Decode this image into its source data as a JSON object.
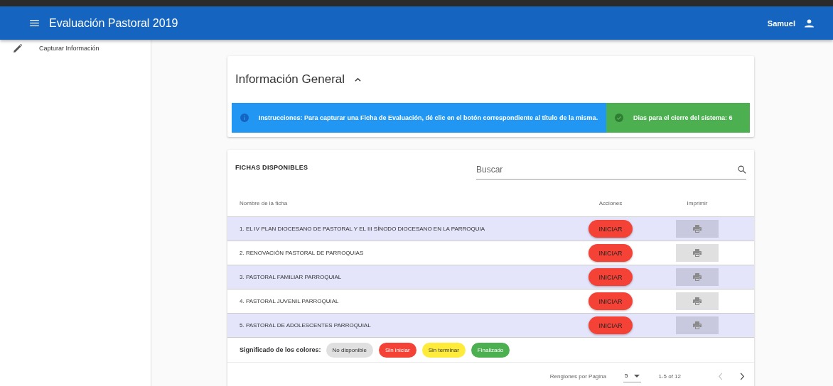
{
  "app_bar": {
    "title": "Evaluación Pastoral 2019",
    "user": "Samuel"
  },
  "sidebar": {
    "items": [
      {
        "label": "Capturar Información",
        "selected": false
      }
    ]
  },
  "general": {
    "title": "Información General",
    "expanded": true,
    "info": "Instrucciones: Para capturar una Ficha de Evaluación, dé clic en el botón correspondiente al título de la misma.",
    "days": "Dias para el cierre del sistema: 6"
  },
  "fichas": {
    "title": "FICHAS DISPONIBLES",
    "search": {
      "placeholder": "Buscar"
    },
    "columns": [
      "Nombre de la ficha",
      "Acciones",
      "Imprimir"
    ],
    "rows": [
      {
        "name": "1. EL IV PLAN DIOCESANO DE PASTORAL Y EL III SÍNODO DIOCESANO EN LA PARROQUIA",
        "action": "INICIAR"
      },
      {
        "name": "2. RENOVACIÓN PASTORAL DE PARROQUIAS",
        "action": "INICIAR"
      },
      {
        "name": "3. PASTORAL FAMILIAR PARROQUIAL",
        "action": "INICIAR"
      },
      {
        "name": "4. PASTORAL JUVENIL PARROQUIAL",
        "action": "INICIAR"
      },
      {
        "name": "5. PASTORAL DE ADOLESCENTES PARROQUIAL",
        "action": "INICIAR"
      }
    ],
    "legend": {
      "label": "Significado de los colores:",
      "items": [
        {
          "label": "No disponible",
          "color": "#e0e0e0"
        },
        {
          "label": "Sin iniciar",
          "color": "#f44336"
        },
        {
          "label": "Sin terminar",
          "color": "#ffeb3b"
        },
        {
          "label": "Finalizado",
          "color": "#4caf50"
        }
      ]
    },
    "pagination": {
      "rows_label": "Renglones por Pagina",
      "rows_per_page": "5",
      "range": "1-5 of 12",
      "prev_disabled": true,
      "next_disabled": false
    }
  }
}
